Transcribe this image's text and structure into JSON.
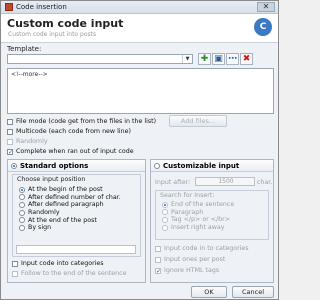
{
  "window": {
    "title": "Code insertion",
    "close_glyph": "✕"
  },
  "header": {
    "title": "Custom code input",
    "subtitle": "Custom code input into posts",
    "logo_letter": "C"
  },
  "template": {
    "label": "Template:",
    "value": ""
  },
  "toolbar": [
    {
      "name": "add-template-icon",
      "glyph": "✚",
      "color": "#2e8b2e"
    },
    {
      "name": "save-template-icon",
      "glyph": "▣",
      "color": "#2b5c9a"
    },
    {
      "name": "more-options-icon",
      "glyph": "⋯",
      "color": "#1f66c1"
    },
    {
      "name": "delete-template-icon",
      "glyph": "✖",
      "color": "#c02020"
    }
  ],
  "editor": {
    "content": "<!--more-->"
  },
  "options": {
    "file_mode": "File mode (code get from the files in the list)",
    "add_files": "Add files...",
    "multicode": "Multicode (each code from new line)",
    "randomly": "Randomly",
    "complete": "Complete when ran out of input code",
    "complete_checked": "✓"
  },
  "standard": {
    "title": "Standard options",
    "group_title": "Choose input position",
    "positions": [
      {
        "label": "At the begin of the post",
        "selected": true
      },
      {
        "label": "After defined number of char.",
        "selected": false
      },
      {
        "label": "After defined paragraph",
        "selected": false
      },
      {
        "label": "Randomly",
        "selected": false
      },
      {
        "label": "At the end of the post",
        "selected": false
      },
      {
        "label": "By sign",
        "selected": false
      }
    ],
    "input_categories": "Input code into categories",
    "follow_end": "Follow to the end of the sentence"
  },
  "custom": {
    "title": "Customizable input",
    "input_after_label": "Input after:",
    "input_after_value": "1500",
    "input_after_unit": "char.",
    "search_title": "Search for Insert:",
    "search_options": [
      {
        "label": "End of the sentence",
        "selected": true
      },
      {
        "label": "Paragraph",
        "selected": false
      },
      {
        "label": "Tag </p> or </br>",
        "selected": false
      },
      {
        "label": "Insert right away",
        "selected": false
      }
    ],
    "input_categories": "Input code in to categories",
    "input_once": "Input ones per post",
    "ignore_html": "Ignore HTML tags",
    "ignore_checked": "✓"
  },
  "footer": {
    "ok": "OK",
    "cancel": "Cancel"
  }
}
